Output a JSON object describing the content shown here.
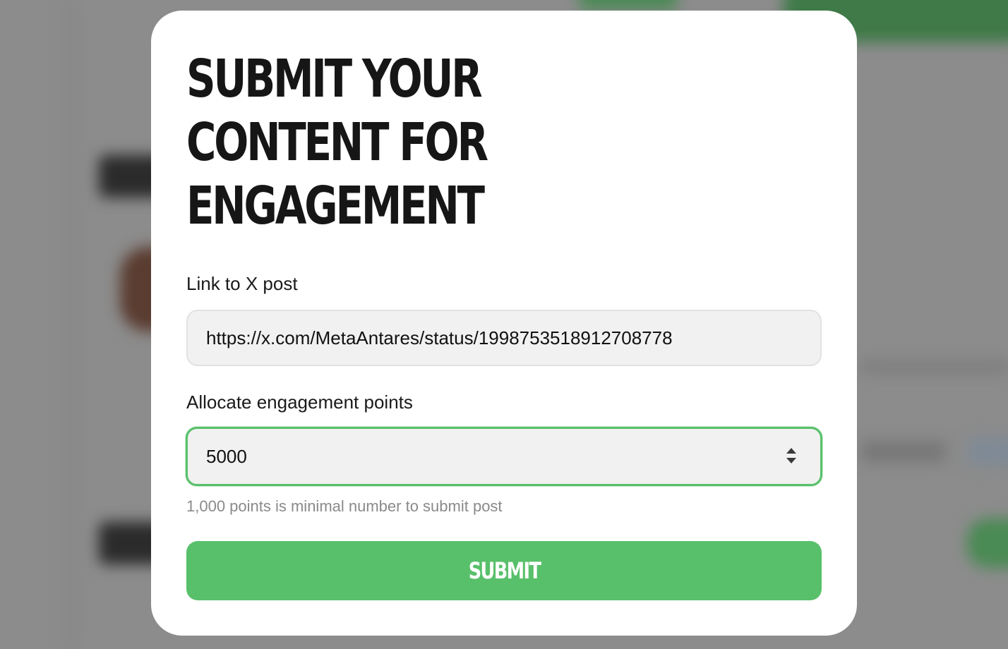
{
  "modal": {
    "title_lines": [
      "SUBMIT YOUR",
      "CONTENT FOR",
      "ENGAGEMENT"
    ],
    "link_label": "Link to X post",
    "link_value": "https://x.com/MetaAntares/status/1998753518912708778",
    "points_label": "Allocate engagement points",
    "points_value": "5000",
    "hint": "1,000 points is minimal number to submit post",
    "submit_label": "SUBMIT"
  },
  "colors": {
    "accent": "#58c06a",
    "title": "#161616",
    "field_bg": "#f1f1f1",
    "hint": "#8a8a8a",
    "backdrop": "#8c8c8c"
  },
  "icons": {
    "points_stepper": "up-down-stepper-icon"
  }
}
